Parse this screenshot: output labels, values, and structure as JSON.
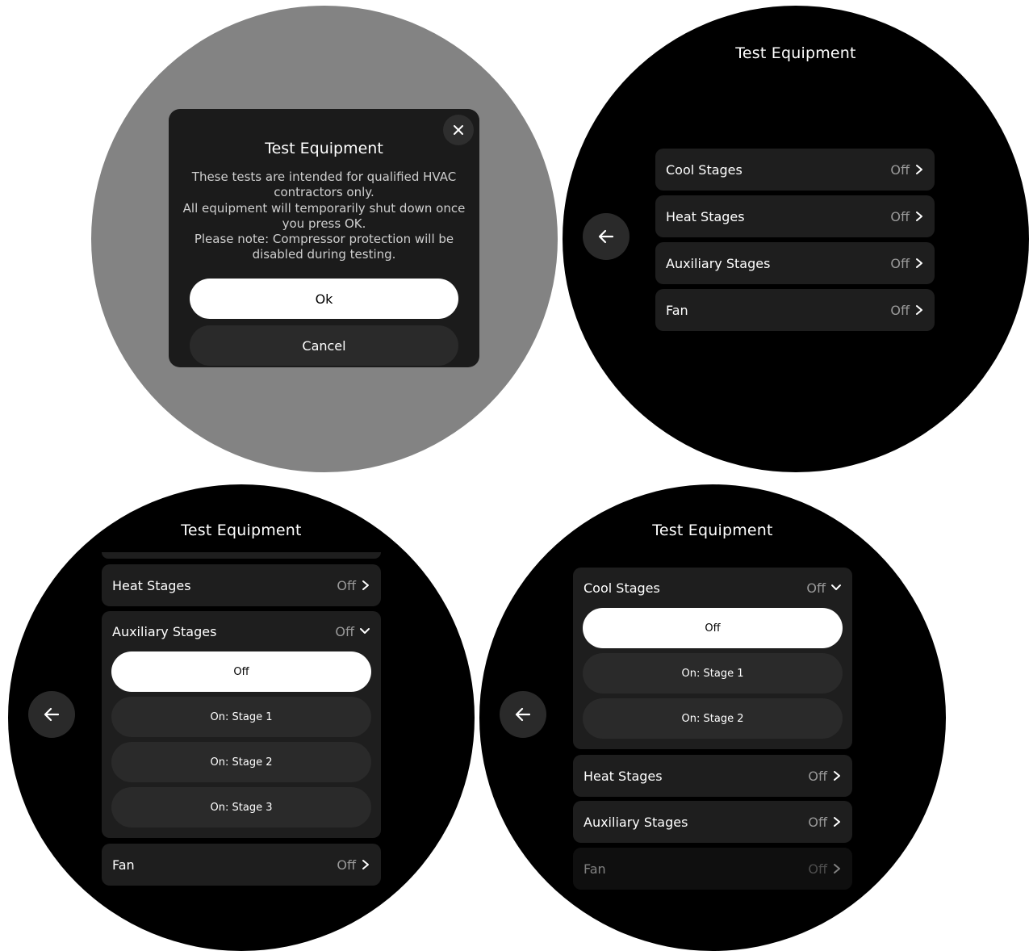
{
  "screens": {
    "dialog_screen": {
      "dialog": {
        "title": "Test Equipment",
        "body": "These tests are intended for qualified HVAC contractors only.\nAll equipment will temporarily shut down once you press OK.\nPlease note: Compressor protection will be disabled during testing.",
        "ok_label": "Ok",
        "cancel_label": "Cancel",
        "close_icon": "close-icon"
      }
    },
    "list_screen": {
      "title": "Test Equipment",
      "back_icon": "arrow-left-icon",
      "rows": [
        {
          "label": "Cool Stages",
          "value": "Off"
        },
        {
          "label": "Heat Stages",
          "value": "Off"
        },
        {
          "label": "Auxiliary Stages",
          "value": "Off"
        },
        {
          "label": "Fan",
          "value": "Off"
        }
      ]
    },
    "aux_screen": {
      "title": "Test Equipment",
      "back_icon": "arrow-left-icon",
      "heat_row": {
        "label": "Heat Stages",
        "value": "Off"
      },
      "aux_group": {
        "label": "Auxiliary Stages",
        "value": "Off",
        "options": [
          "Off",
          "On: Stage 1",
          "On: Stage 2",
          "On: Stage 3"
        ],
        "selected": "Off"
      },
      "fan_row": {
        "label": "Fan",
        "value": "Off"
      }
    },
    "cool_screen": {
      "title": "Test Equipment",
      "back_icon": "arrow-left-icon",
      "cool_group": {
        "label": "Cool Stages",
        "value": "Off",
        "options": [
          "Off",
          "On: Stage 1",
          "On: Stage 2"
        ],
        "selected": "Off"
      },
      "rows": [
        {
          "label": "Heat Stages",
          "value": "Off"
        },
        {
          "label": "Auxiliary Stages",
          "value": "Off"
        },
        {
          "label": "Fan",
          "value": "Off"
        }
      ]
    }
  },
  "colors": {
    "screen_bg": "#000000",
    "dim_bg": "#838383",
    "row_bg": "#1e1e1e",
    "option_bg": "#2a2a2a",
    "selected_bg": "#ffffff",
    "value_text": "#9a9a9a"
  }
}
